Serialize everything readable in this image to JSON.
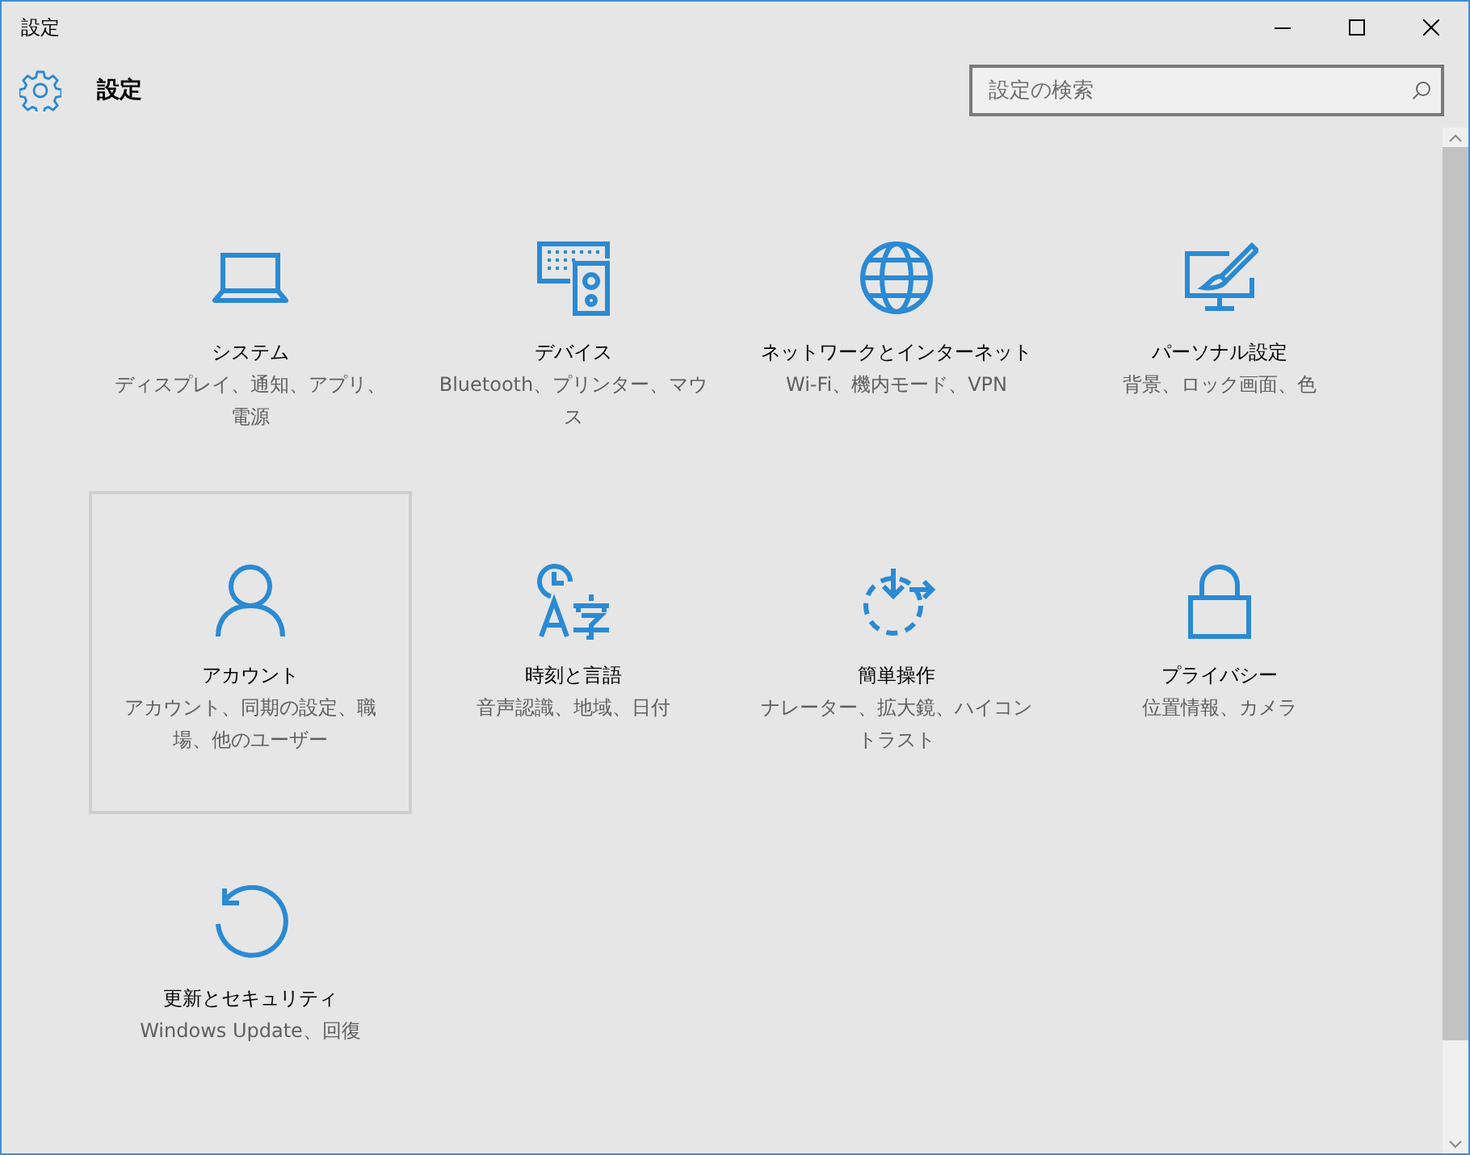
{
  "window": {
    "title": "設定"
  },
  "header": {
    "title": "設定"
  },
  "search": {
    "placeholder": "設定の検索"
  },
  "tiles": [
    {
      "kind": "laptop",
      "title": "システム",
      "description": "ディスプレイ、通知、アプリ、電源",
      "hovered": false
    },
    {
      "kind": "devices",
      "title": "デバイス",
      "description": "Bluetooth、プリンター、マウス",
      "hovered": false
    },
    {
      "kind": "globe",
      "title": "ネットワークとインターネット",
      "description": "Wi-Fi、機内モード、VPN",
      "hovered": false
    },
    {
      "kind": "paint",
      "title": "パーソナル設定",
      "description": "背景、ロック画面、色",
      "hovered": false
    },
    {
      "kind": "person",
      "title": "アカウント",
      "description": "アカウント、同期の設定、職場、他のユーザー",
      "hovered": true
    },
    {
      "kind": "clock-lang",
      "title": "時刻と言語",
      "description": "音声認識、地域、日付",
      "hovered": false
    },
    {
      "kind": "ease",
      "title": "簡単操作",
      "description": "ナレーター、拡大鏡、ハイコントラスト",
      "hovered": false
    },
    {
      "kind": "lock",
      "title": "プライバシー",
      "description": "位置情報、カメラ",
      "hovered": false
    },
    {
      "kind": "update",
      "title": "更新とセキュリティ",
      "description": "Windows Update、回復",
      "hovered": false
    }
  ]
}
